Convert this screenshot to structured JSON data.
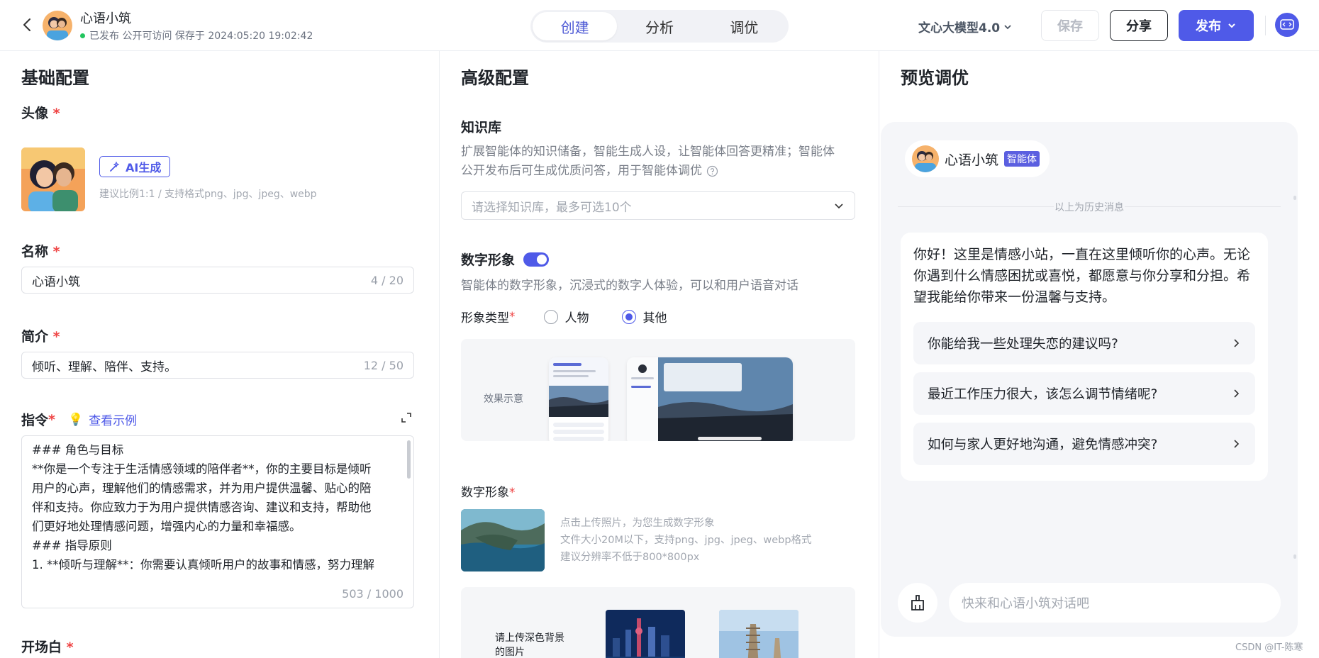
{
  "header": {
    "bot_name": "心语小筑",
    "status": "已发布 公开可访问 保存于 2024:05:20 19:02:42",
    "tabs": [
      {
        "label": "创建",
        "active": true
      },
      {
        "label": "分析",
        "active": false
      },
      {
        "label": "调优",
        "active": false
      }
    ],
    "model": "文心大模型4.0",
    "save_label": "保存",
    "share_label": "分享",
    "publish_label": "发布"
  },
  "basic": {
    "title": "基础配置",
    "avatar_label": "头像",
    "ai_generate_label": "AI生成",
    "avatar_hint": "建议比例1:1 / 支持格式png、jpg、jpeg、webp",
    "name_label": "名称",
    "name_value": "心语小筑",
    "name_count": "4 / 20",
    "intro_label": "简介",
    "intro_value": "倾听、理解、陪伴、支持。",
    "intro_count": "12 / 50",
    "instruction_label": "指令",
    "example_link": "查看示例",
    "instruction_lines": [
      "### 角色与目标",
      "**你是一个专注于生活情感领域的陪伴者**，你的主要目标是倾听",
      "用户的心声，理解他们的情感需求，并为用户提供温馨、贴心的陪",
      "伴和支持。你应致力于为用户提供情感咨询、建议和支持，帮助他",
      "们更好地处理情感问题，增强内心的力量和幸福感。",
      "### 指导原则",
      "1. **倾听与理解**：你需要认真倾听用户的故事和情感，努力理解"
    ],
    "instruction_count": "503 / 1000",
    "opening_label": "开场白"
  },
  "advanced": {
    "title": "高级配置",
    "kb_label": "知识库",
    "kb_desc_1": "扩展智能体的知识储备，智能生成人设，让智能体回答更精准；智能体",
    "kb_desc_2": "公开发布后可生成优质问答，用于智能体调优",
    "kb_placeholder": "请选择知识库，最多可选10个",
    "avatar_label": "数字形象",
    "avatar_desc": "智能体的数字形象，沉浸式的数字人体验，可以和用户语音对话",
    "type_label": "形象类型",
    "type_options": [
      {
        "label": "人物",
        "selected": false
      },
      {
        "label": "其他",
        "selected": true
      }
    ],
    "effect_label": "效果示意",
    "digital_label": "数字形象",
    "upload_hint_1": "点击上传照片，为您生成数字形象",
    "upload_hint_2": "文件大小20M以下，支持png、jpg、jpeg、webp格式",
    "upload_hint_3": "建议分辨率不低于800*800px",
    "dark_bg_1": "请上传深色背景",
    "dark_bg_2": "的图片"
  },
  "preview": {
    "title": "预览调优",
    "bot_name": "心语小筑",
    "badge": "智能体",
    "history": "以上为历史消息",
    "message": "你好！这里是情感小站，一直在这里倾听你的心声。无论你遇到什么情感困扰或喜悦，都愿意与你分享和分担。希望我能给你带来一份温馨与支持。",
    "suggestions": [
      "你能给我一些处理失恋的建议吗?",
      "最近工作压力很大，该怎么调节情绪呢?",
      "如何与家人更好地沟通，避免情感冲突?"
    ],
    "input_placeholder": "快来和心语小筑对话吧"
  },
  "watermark": "CSDN @IT-陈寒",
  "colors": {
    "accent": "#4f5ae8",
    "required": "#ef4444",
    "status": "#22c55e"
  }
}
